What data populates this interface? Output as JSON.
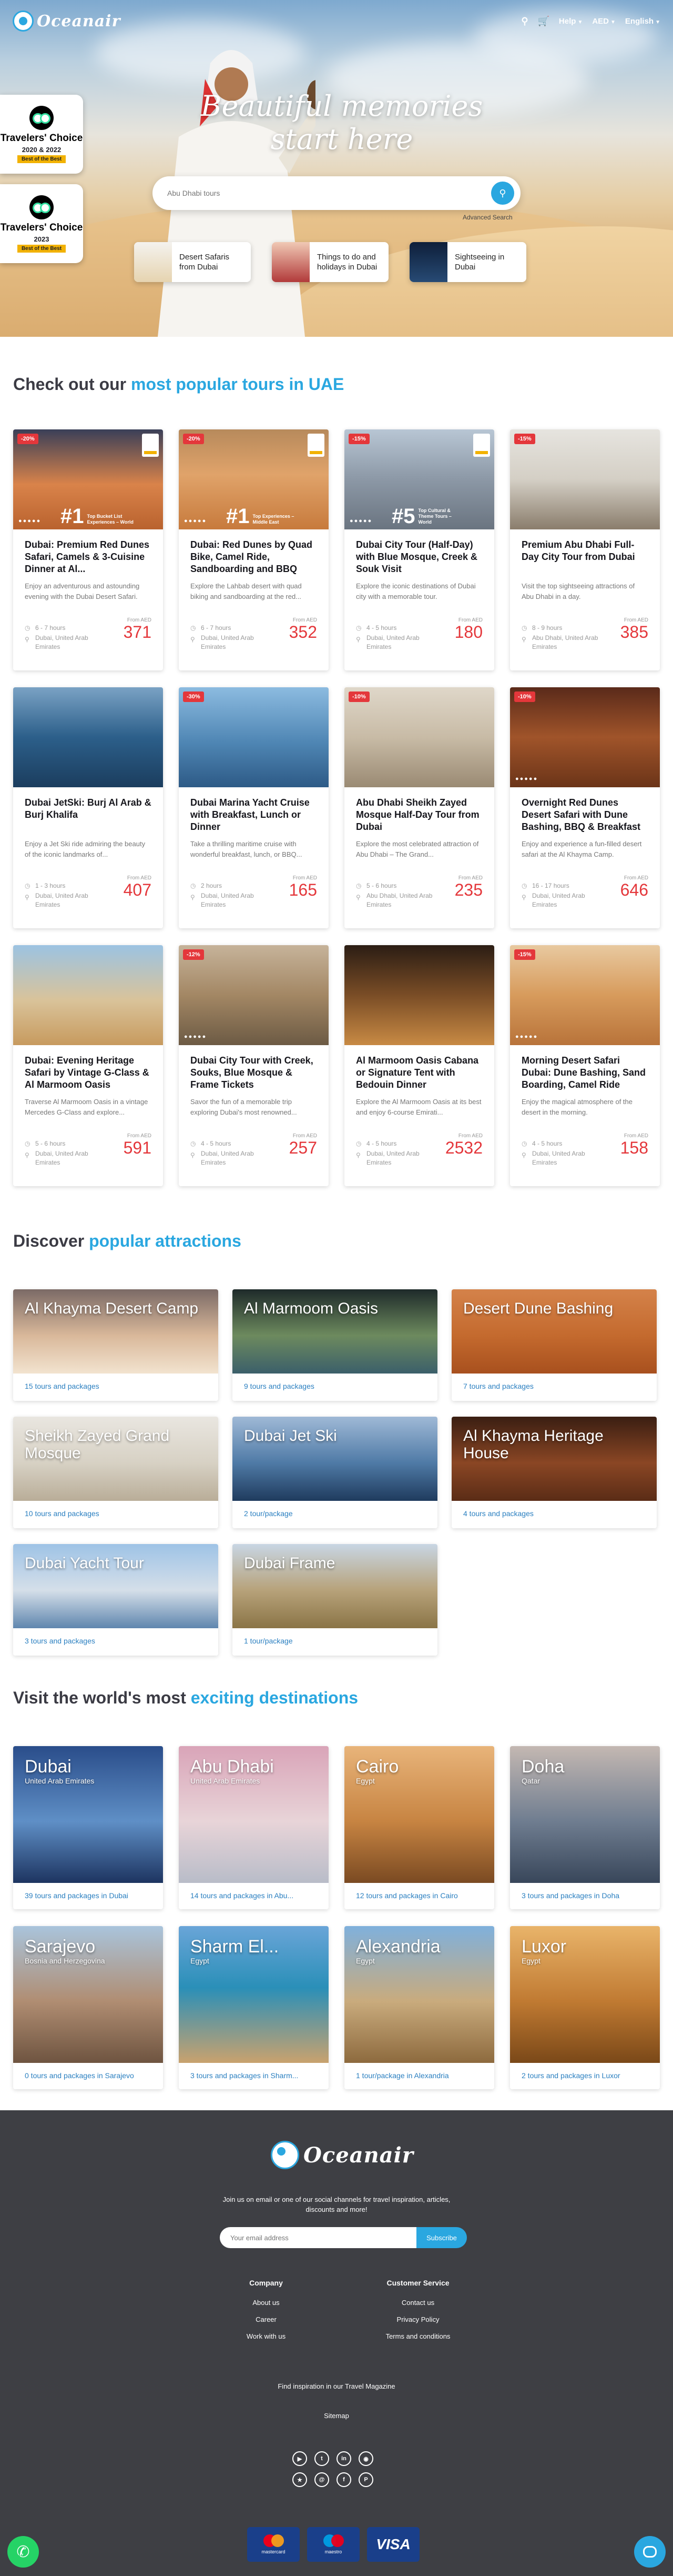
{
  "header": {
    "logo_text": "Oceanair",
    "help": "Help",
    "currency": "AED",
    "language": "English"
  },
  "hero": {
    "tagline": "Beautiful memories start here",
    "search_placeholder": "Abu Dhabi tours",
    "advanced_search": "Advanced Search",
    "badges": [
      {
        "title": "Travelers' Choice",
        "years": "2020 & 2022",
        "label": "Best of the Best"
      },
      {
        "title": "Travelers' Choice",
        "years": "2023",
        "label": "Best of the Best"
      }
    ],
    "chips": [
      "Desert Safaris from Dubai",
      "Things to do and holidays in Dubai",
      "Sightseeing in Dubai"
    ]
  },
  "tours_section": {
    "title_prefix": "Check out our ",
    "title_highlight": "most popular tours in UAE",
    "from_label": "From AED",
    "tours": [
      {
        "discount": "-20%",
        "title": "Dubai: Premium Red Dunes Safari, Camels & 3-Cuisine Dinner at Al...",
        "desc": "Enjoy an adventurous and astounding evening with the Dubai Desert Safari.",
        "duration": "6 - 7 hours",
        "location": "Dubai, United Arab Emirates",
        "price": "371",
        "award_num": "#1",
        "award_text": "Top Bucket List Experiences – World"
      },
      {
        "discount": "-20%",
        "title": "Dubai: Red Dunes by Quad Bike, Camel Ride, Sandboarding and BBQ",
        "desc": "Explore the Lahbab desert with quad biking and sandboarding at the red...",
        "duration": "6 - 7 hours",
        "location": "Dubai, United Arab Emirates",
        "price": "352",
        "award_num": "#1",
        "award_text": "Top Experiences – Middle East"
      },
      {
        "discount": "-15%",
        "title": "Dubai City Tour (Half-Day) with Blue Mosque, Creek & Souk Visit",
        "desc": "Explore the iconic destinations of Dubai city with a memorable tour.",
        "duration": "4 - 5 hours",
        "location": "Dubai, United Arab Emirates",
        "price": "180",
        "award_num": "#5",
        "award_text": "Top Cultural & Theme Tours – World"
      },
      {
        "discount": "-15%",
        "title": "Premium Abu Dhabi Full-Day City Tour from Dubai",
        "desc": "Visit the top sightseeing attractions of Abu Dhabi in a day.",
        "duration": "8 - 9 hours",
        "location": "Abu Dhabi, United Arab Emirates",
        "price": "385"
      },
      {
        "discount": "",
        "title": "Dubai JetSki: Burj Al Arab & Burj Khalifa",
        "desc": "Enjoy a Jet Ski ride admiring the beauty of the iconic landmarks of...",
        "duration": "1 - 3 hours",
        "location": "Dubai, United Arab Emirates",
        "price": "407"
      },
      {
        "discount": "-30%",
        "title": "Dubai Marina Yacht Cruise with Breakfast, Lunch or Dinner",
        "desc": "Take a thrilling maritime cruise with wonderful breakfast, lunch, or BBQ...",
        "duration": "2 hours",
        "location": "Dubai, United Arab Emirates",
        "price": "165"
      },
      {
        "discount": "-10%",
        "title": "Abu Dhabi Sheikh Zayed Mosque Half-Day Tour from Dubai",
        "desc": "Explore the most celebrated attraction of Abu Dhabi – The Grand...",
        "duration": "5 - 6 hours",
        "location": "Abu Dhabi, United Arab Emirates",
        "price": "235"
      },
      {
        "discount": "-10%",
        "title": "Overnight Red Dunes Desert Safari with Dune Bashing, BBQ & Breakfast",
        "desc": "Enjoy and experience a fun-filled desert safari at the Al Khayma Camp.",
        "duration": "16 - 17 hours",
        "location": "Dubai, United Arab Emirates",
        "price": "646"
      },
      {
        "discount": "",
        "title": "Dubai: Evening Heritage Safari by Vintage G-Class & Al Marmoom Oasis",
        "desc": "Traverse Al Marmoom Oasis in a vintage Mercedes G-Class and explore...",
        "duration": "5 - 6 hours",
        "location": "Dubai, United Arab Emirates",
        "price": "591"
      },
      {
        "discount": "-12%",
        "title": "Dubai City Tour with Creek, Souks, Blue Mosque & Frame Tickets",
        "desc": "Savor the fun of a memorable trip exploring Dubai's most renowned...",
        "duration": "4 - 5 hours",
        "location": "Dubai, United Arab Emirates",
        "price": "257"
      },
      {
        "discount": "",
        "title": "Al Marmoom Oasis Cabana or Signature Tent with Bedouin Dinner",
        "desc": "Explore the Al Marmoom Oasis at its best and enjoy 6-course Emirati...",
        "duration": "4 - 5 hours",
        "location": "Dubai, United Arab Emirates",
        "price": "2532"
      },
      {
        "discount": "-15%",
        "title": "Morning Desert Safari Dubai: Dune Bashing, Sand Boarding, Camel Ride",
        "desc": "Enjoy the magical atmosphere of the desert in the morning.",
        "duration": "4 - 5 hours",
        "location": "Dubai, United Arab Emirates",
        "price": "158"
      }
    ]
  },
  "attractions_section": {
    "title_prefix": "Discover ",
    "title_highlight": "popular attractions",
    "items": [
      {
        "name": "Al Khayma Desert Camp",
        "count": "15 tours and packages"
      },
      {
        "name": "Al Marmoom Oasis",
        "count": "9 tours and packages"
      },
      {
        "name": "Desert Dune Bashing",
        "count": "7 tours and packages"
      },
      {
        "name": "Sheikh Zayed Grand Mosque",
        "count": "10 tours and packages"
      },
      {
        "name": "Dubai Jet Ski",
        "count": "2 tour/package"
      },
      {
        "name": "Al Khayma Heritage House",
        "count": "4 tours and packages"
      },
      {
        "name": "Dubai Yacht Tour",
        "count": "3 tours and packages"
      },
      {
        "name": "Dubai Frame",
        "count": "1 tour/package"
      }
    ]
  },
  "destinations_section": {
    "title_prefix": "Visit the world's most ",
    "title_highlight": "exciting destinations",
    "items": [
      {
        "name": "Dubai",
        "country": "United Arab Emirates",
        "count": "39 tours and packages in Dubai"
      },
      {
        "name": "Abu Dhabi",
        "country": "United Arab Emirates",
        "count": "14 tours and packages in Abu..."
      },
      {
        "name": "Cairo",
        "country": "Egypt",
        "count": "12 tours and packages in Cairo"
      },
      {
        "name": "Doha",
        "country": "Qatar",
        "count": "3 tours and packages in Doha"
      },
      {
        "name": "Sarajevo",
        "country": "Bosnia and Herzegovina",
        "count": "0 tours and packages in Sarajevo"
      },
      {
        "name": "Sharm El...",
        "country": "Egypt",
        "count": "3 tours and packages in Sharm..."
      },
      {
        "name": "Alexandria",
        "country": "Egypt",
        "count": "1 tour/package in Alexandria"
      },
      {
        "name": "Luxor",
        "country": "Egypt",
        "count": "2 tours and packages in Luxor"
      }
    ]
  },
  "footer": {
    "logo_text": "Oceanair",
    "join_text": "Join us on email or one of our social channels for travel inspiration, articles, discounts and more!",
    "email_placeholder": "Your email address",
    "subscribe": "Subscribe",
    "company": {
      "title": "Company",
      "links": [
        "About us",
        "Career",
        "Work with us"
      ]
    },
    "customer_service": {
      "title": "Customer Service",
      "links": [
        "Contact us",
        "Privacy Policy",
        "Terms and conditions"
      ]
    },
    "inspiration": "Find inspiration in our Travel Magazine",
    "sitemap": "Sitemap",
    "socials": [
      "youtube-icon",
      "twitter-icon",
      "linkedin-icon",
      "instagram-icon",
      "facebook-icon",
      "pinterest-icon",
      "tripadvisor-icon",
      "email-icon"
    ],
    "payments": [
      "mastercard",
      "maestro",
      "VISA"
    ]
  },
  "colors": {
    "accent": "#2aa7e0",
    "price": "#e4373b",
    "footer_bg": "#3e3f44",
    "badge_yellow": "#f2b203"
  }
}
